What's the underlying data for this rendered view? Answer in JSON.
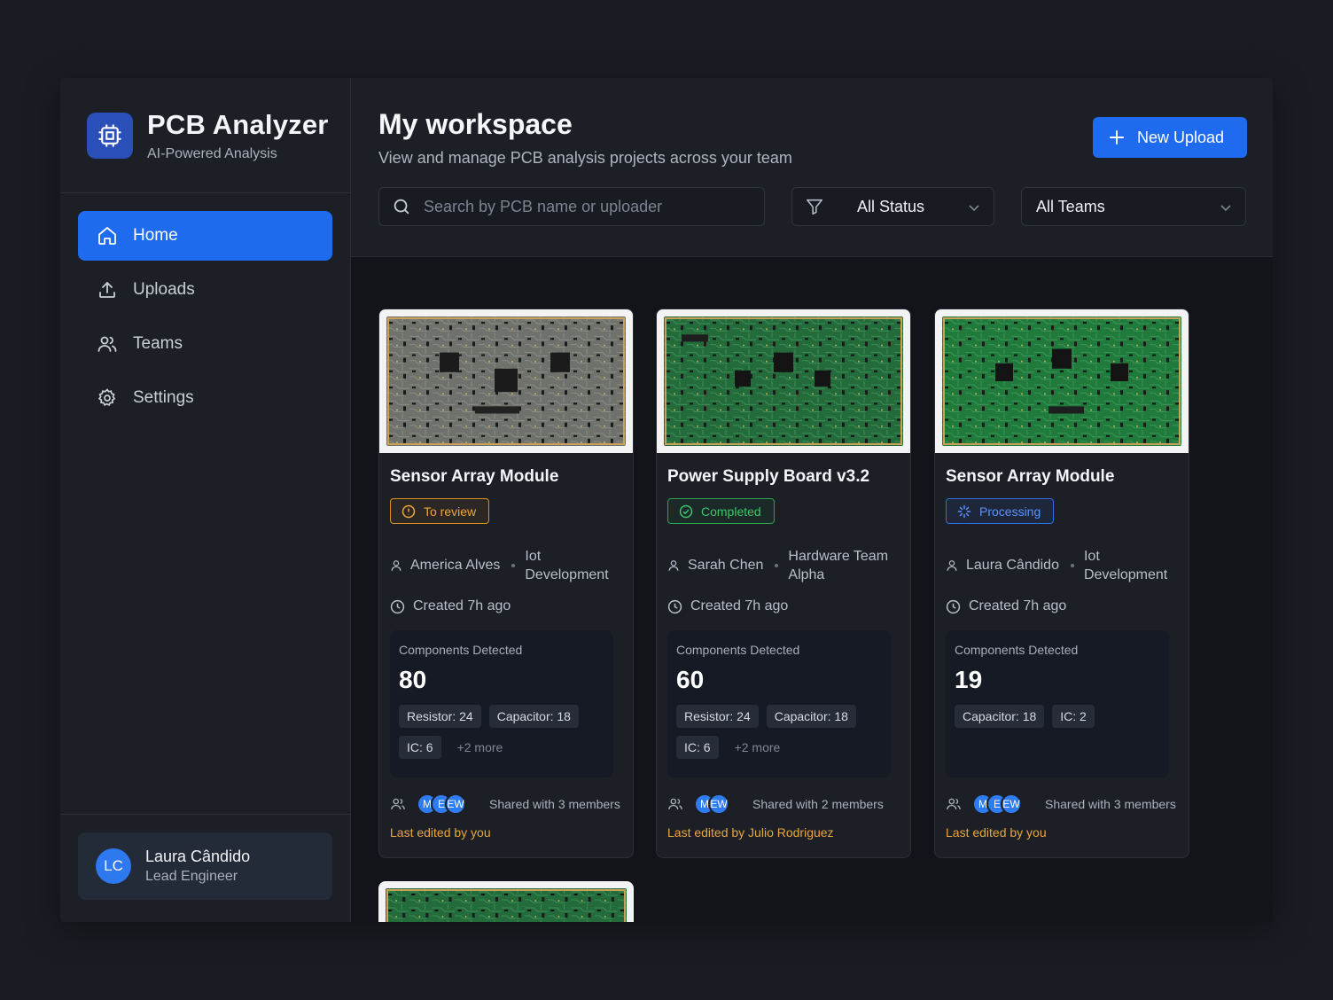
{
  "brand": {
    "title": "PCB Analyzer",
    "subtitle": "AI-Powered Analysis"
  },
  "nav": [
    {
      "label": "Home",
      "icon": "home-icon",
      "active": true
    },
    {
      "label": "Uploads",
      "icon": "upload-icon",
      "active": false
    },
    {
      "label": "Teams",
      "icon": "users-icon",
      "active": false
    },
    {
      "label": "Settings",
      "icon": "gear-icon",
      "active": false
    }
  ],
  "user": {
    "initials": "LC",
    "name": "Laura Cândido",
    "role": "Lead Engineer"
  },
  "header": {
    "title": "My workspace",
    "subtitle": "View and manage PCB analysis projects across your team",
    "new_upload": "New Upload"
  },
  "filters": {
    "search_placeholder": "Search by PCB name or uploader",
    "status": "All Status",
    "teams": "All Teams"
  },
  "cards": [
    {
      "title": "Sensor Array Module",
      "status": "To review",
      "uploader": "America Alves",
      "team": "Iot Development",
      "created": "Created 7h ago",
      "components_label": "Components Detected",
      "components_count": "80",
      "chips": [
        "Resistor: 24",
        "Capacitor: 18",
        "IC: 6"
      ],
      "more": "+2 more",
      "avatars": [
        "M",
        "E",
        "EW"
      ],
      "shared": "Shared with 3 members",
      "edited": "Last edited by you"
    },
    {
      "title": "Power Supply Board v3.2",
      "status": "Completed",
      "uploader": "Sarah Chen",
      "team": "Hardware Team Alpha",
      "created": "Created 7h ago",
      "components_label": "Components Detected",
      "components_count": "60",
      "chips": [
        "Resistor: 24",
        "Capacitor: 18",
        "IC: 6"
      ],
      "more": "+2 more",
      "avatars": [
        "M",
        "EW"
      ],
      "shared": "Shared with 2 members",
      "edited": "Last edited by Julio Rodriguez"
    },
    {
      "title": "Sensor Array Module",
      "status": "Processing",
      "uploader": "Laura Cândido",
      "team": "Iot Development",
      "created": "Created 7h ago",
      "components_label": "Components Detected",
      "components_count": "19",
      "chips": [
        "Capacitor: 18",
        "IC: 2"
      ],
      "more": "",
      "avatars": [
        "M",
        "E",
        "EW"
      ],
      "shared": "Shared with 3 members",
      "edited": "Last edited by you"
    }
  ],
  "colors": {
    "accent": "#1f6bf0",
    "review": "#f0a43a",
    "completed": "#3fc46a",
    "processing": "#5a93ff"
  }
}
